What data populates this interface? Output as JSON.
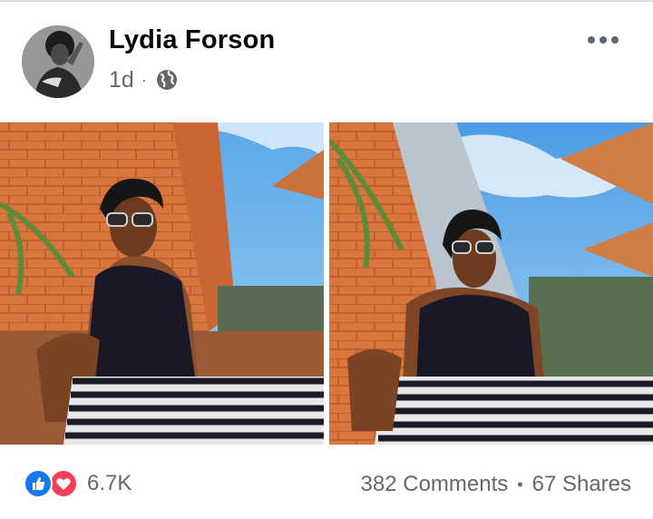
{
  "post": {
    "author": "Lydia Forson",
    "time": "1d",
    "meta_separator": "·",
    "privacy_icon": "globe-icon",
    "more_icon": "more-options-icon"
  },
  "photos": [
    {
      "alt": "Woman in sunglasses, black tank top and striped trousers posing by a brick wall"
    },
    {
      "alt": "Woman in sunglasses, black tank top and striped trousers posing by a brick wall under a blue sky"
    }
  ],
  "footer": {
    "reaction_icons": [
      "like-icon",
      "love-icon"
    ],
    "reaction_count": "6.7K",
    "comments": "382 Comments",
    "separator": "•",
    "shares": "67 Shares"
  },
  "colors": {
    "name": "#050505",
    "meta": "#65676b",
    "like": "#1877f2",
    "love": "#f33e58"
  }
}
